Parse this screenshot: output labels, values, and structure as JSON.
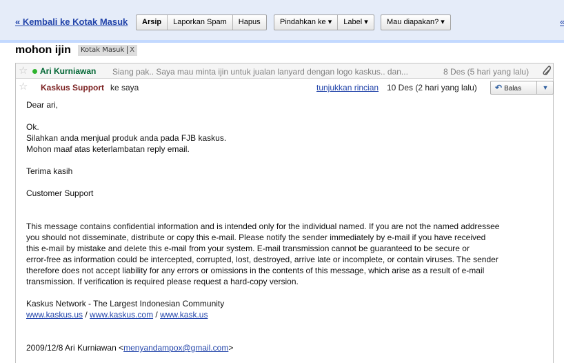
{
  "toolbar": {
    "back_link": "« Kembali ke Kotak Masuk",
    "group1": [
      "Arsip",
      "Laporkan Spam",
      "Hapus"
    ],
    "move_to": "Pindahkan ke ▾",
    "label": "Label ▾",
    "more_actions": "Mau diapakan? ▾",
    "right_link": "«"
  },
  "thread": {
    "subject": "mohon ijin",
    "label_chip": "Kotak Masuk",
    "label_remove": "X"
  },
  "collapsed_message": {
    "star": "☆",
    "sender": "Ari Kurniawan",
    "snippet": "Siang pak.. Saya mau minta ijin untuk jualan lanyard dengan logo kaskus.. dan...",
    "date": "8 Des (5 hari yang lalu)",
    "attachment_icon": "paperclip-icon"
  },
  "message": {
    "star": "☆",
    "sender": "Kaskus Support",
    "to": "ke saya",
    "details_link": "tunjukkan rincian",
    "date": "10 Des (2 hari yang lalu)",
    "reply_label": "Balas",
    "reply_arrow": "↶",
    "reply_dropdown": "▼",
    "body": {
      "greeting": "Dear ari,",
      "line_ok": "Ok.",
      "line_sell": "Silahkan anda menjual produk anda pada FJB kaskus.",
      "line_sorry": "Mohon maaf atas keterlambatan reply email.",
      "thanks": "Terima kasih",
      "signature": "Customer Support",
      "disclaimer": [
        "This message contains confidential information and is intended only for the individual named. If you are not the named addressee",
        "you should not disseminate, distribute or copy this e-mail. Please notify the sender immediately by e-mail if you have received",
        "this e-mail by mistake and delete this e-mail from your system. E-mail transmission cannot be guaranteed to be secure or",
        "error-free as information could be intercepted, corrupted, lost, destroyed, arrive late or incomplete, or contain viruses. The sender",
        "therefore does not accept liability for any errors or omissions in the contents of this message, which arise as a result of e-mail",
        "transmission. If verification is required please request a hard-copy version."
      ],
      "network": "Kaskus Network - The Largest Indonesian Community",
      "links": [
        "www.kaskus.us",
        "www.kaskus.com",
        "www.kask.us"
      ],
      "link_sep": " / ",
      "quote_prefix": "2009/12/8 Ari Kurniawan <",
      "quote_email": "menyandampox@gmail.com",
      "quote_suffix": ">"
    }
  }
}
